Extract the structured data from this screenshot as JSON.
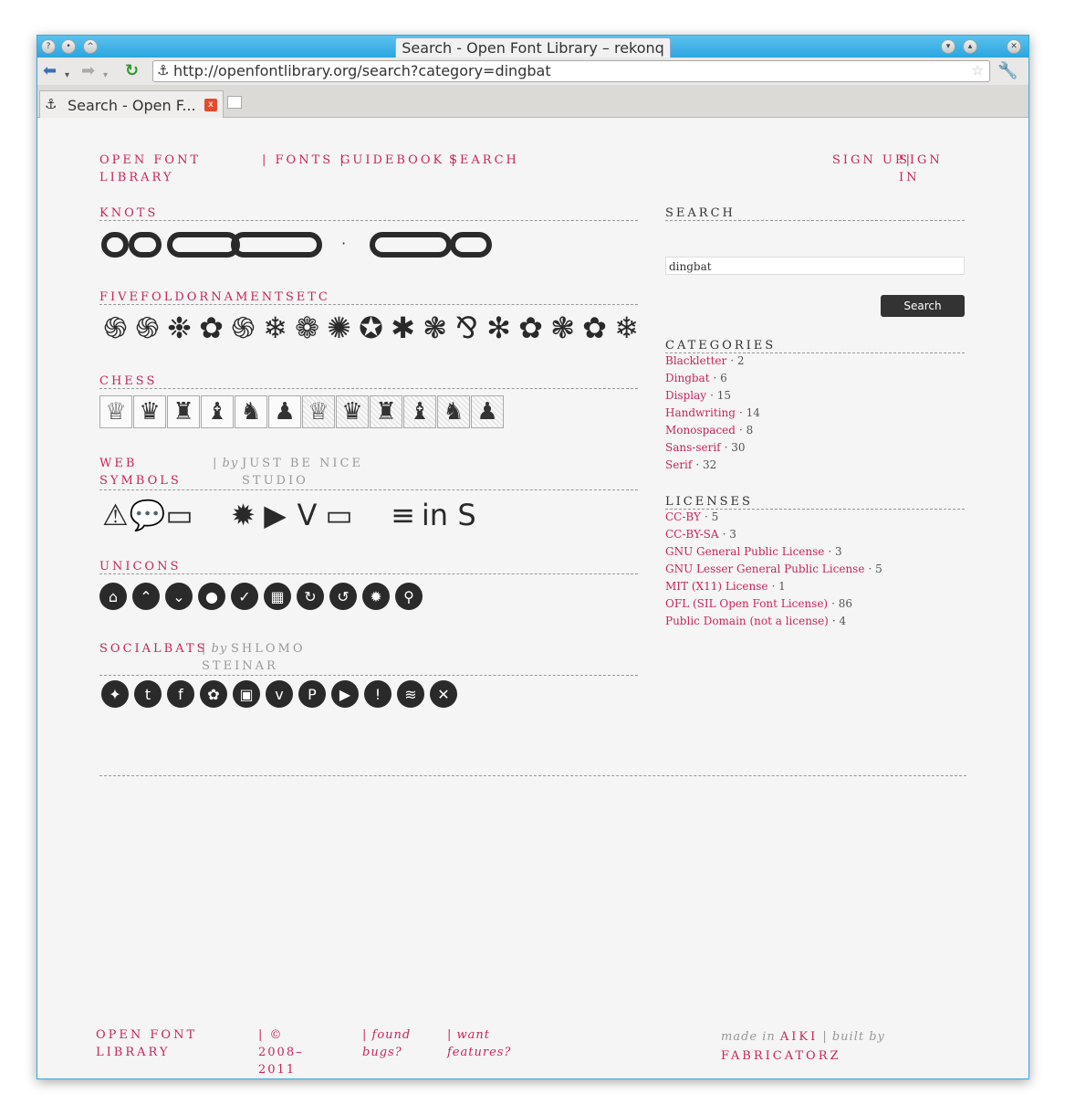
{
  "window": {
    "title": "Search - Open Font Library – rekonq",
    "url": "http://openfontlibrary.org/search?category=dingbat",
    "tab_label": "Search - Open F...",
    "btn_help": "?",
    "btn_min": "▾",
    "btn_max": "▴",
    "btn_close": "✕"
  },
  "nav": {
    "site_title": "Open Font Library",
    "fonts": "| Fonts |",
    "guidebook": "Guidebook |",
    "search": "Search",
    "signup": "Sign Up|",
    "signin": "Sign In"
  },
  "fonts": [
    {
      "name": "Knots",
      "by": "",
      "author": ""
    },
    {
      "name": "FiveFoldOrnamentsEtc",
      "by": "",
      "author": ""
    },
    {
      "name": "Chess",
      "by": "",
      "author": ""
    },
    {
      "name": "Web Symbols",
      "by": "| by",
      "author": "Just Be Nice Studio"
    },
    {
      "name": "Unicons",
      "by": "",
      "author": ""
    },
    {
      "name": "SocialBats",
      "by": "| by",
      "author": "Shlomo Steinar"
    }
  ],
  "previews": {
    "knots_dot": "·",
    "fivefold": [
      "֍",
      "֍",
      "❉",
      "✿",
      "֍",
      "❄",
      "❁",
      "✺",
      "✪",
      "✱",
      "❃",
      "⅋",
      "✻",
      "✿",
      "❃",
      "✿",
      "❄"
    ],
    "chess": [
      "♕",
      "♛",
      "♜",
      "♝",
      "♞",
      "♟",
      "♕",
      "♛",
      "♜",
      "♝",
      "♞",
      "♟"
    ],
    "websymbols": [
      "⚠",
      "💬",
      "▭",
      "",
      "✹",
      "▶",
      "V",
      "▭",
      "",
      "≡",
      "in",
      "S"
    ],
    "unicons": [
      "⌂",
      "⌃",
      "⌄",
      "●",
      "✓",
      "▦",
      "↻",
      "↺",
      "✹",
      "⚲"
    ],
    "socialbats": [
      "✦",
      "t",
      "f",
      "✿",
      "▣",
      "v",
      "P",
      "▶",
      "!",
      "≋",
      "✕"
    ]
  },
  "sidebar": {
    "search_heading": "Search",
    "search_value": "dingbat",
    "search_button": "Search",
    "categories_heading": "Categories",
    "categories": [
      {
        "name": "Blackletter",
        "count": "· 2"
      },
      {
        "name": "Dingbat",
        "count": "· 6"
      },
      {
        "name": "Display",
        "count": "· 15"
      },
      {
        "name": "Handwriting",
        "count": "· 14"
      },
      {
        "name": "Monospaced",
        "count": "· 8"
      },
      {
        "name": "Sans-serif",
        "count": "· 30"
      },
      {
        "name": "Serif",
        "count": "· 32"
      }
    ],
    "licenses_heading": "Licenses",
    "licenses": [
      {
        "name": "CC-BY",
        "count": "· 5"
      },
      {
        "name": "CC-BY-SA",
        "count": "· 3"
      },
      {
        "name": "GNU General Public License",
        "count": "· 3"
      },
      {
        "name": "GNU Lesser General Public License",
        "count": "· 5"
      },
      {
        "name": "MIT (X11) License",
        "count": "· 1"
      },
      {
        "name": "OFL (SIL Open Font License)",
        "count": "· 86"
      },
      {
        "name": "Public Domain (not a license)",
        "count": "· 4"
      }
    ]
  },
  "footer": {
    "site": "Open Font Library",
    "copyright": "| © 2008–2011",
    "bugs": "| found bugs?",
    "features": "| want features?",
    "made_in": "made in",
    "aiki": "AIKI",
    "built_by": "| built by",
    "fabricatorz": "Fabricatorz"
  },
  "colors": {
    "accent": "#c8245e",
    "title_bar": "#2aa5df"
  }
}
